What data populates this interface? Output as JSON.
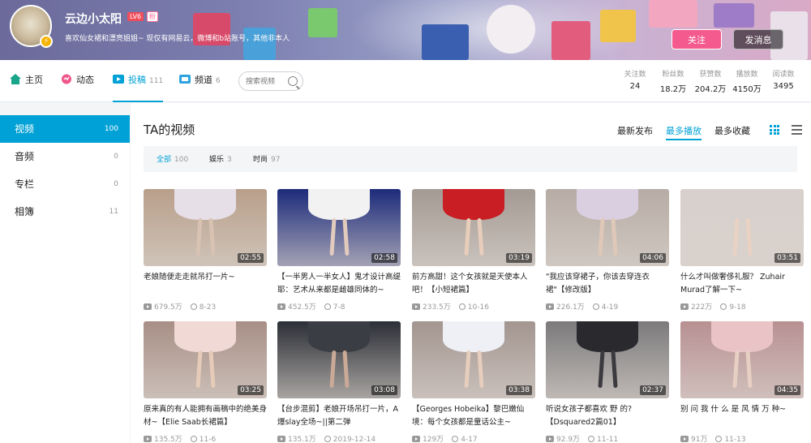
{
  "header": {
    "username": "云边小太阳",
    "level": "LV6",
    "fan_tag": "粉",
    "signature": "喜欢仙女裙和漂亮姐姐~ 现仅有网易云，微博和b站账号，其他非本人",
    "follow_label": "关注",
    "message_label": "发消息",
    "avatar_badge": "⚡"
  },
  "nav": {
    "tabs": [
      {
        "label": "主页",
        "count": ""
      },
      {
        "label": "动态",
        "count": ""
      },
      {
        "label": "投稿",
        "count": "111"
      },
      {
        "label": "频道",
        "count": "6"
      }
    ],
    "search_placeholder": "搜索视频",
    "stats": [
      {
        "label": "关注数",
        "value": "24"
      },
      {
        "label": "粉丝数",
        "value": "18.2万"
      },
      {
        "label": "获赞数",
        "value": "204.2万"
      },
      {
        "label": "播放数",
        "value": "4150万"
      },
      {
        "label": "阅读数",
        "value": "3495"
      }
    ]
  },
  "sidebar": {
    "items": [
      {
        "label": "视频",
        "count": "100"
      },
      {
        "label": "音频",
        "count": "0"
      },
      {
        "label": "专栏",
        "count": "0"
      },
      {
        "label": "相簿",
        "count": "11"
      }
    ]
  },
  "main": {
    "title": "TA的视频",
    "sort": [
      "最新发布",
      "最多播放",
      "最多收藏"
    ],
    "filters": [
      {
        "label": "全部",
        "count": "100"
      },
      {
        "label": "娱乐",
        "count": "3"
      },
      {
        "label": "时尚",
        "count": "97"
      }
    ],
    "videos": [
      {
        "title": "老娘随便走走就吊打一片~",
        "duration": "02:55",
        "plays": "679.5万",
        "date": "8-23",
        "bg": "#b89f8a",
        "skirt": "#e6dfe8",
        "leg": "#d8c2b2"
      },
      {
        "title": "【一半男人一半女人】鬼才设计高缇耶：艺术从来都是雌雄同体的~",
        "duration": "02:58",
        "plays": "452.5万",
        "date": "7-8",
        "bg": "#1d2b7a",
        "skirt": "#f2f2f2",
        "leg": "#e2cbbd"
      },
      {
        "title": "前方高甜！这个女孩就是天使本人吧！【小短裙篇】",
        "duration": "03:19",
        "plays": "233.5万",
        "date": "10-16",
        "bg": "#a49a94",
        "skirt": "#c81e24",
        "leg": "#e8cdbb"
      },
      {
        "title": "\"我应该穿裙子，你该去穿连衣裙\"【修改版】",
        "duration": "04:06",
        "plays": "226.1万",
        "date": "4-19",
        "bg": "#b7aca5",
        "skirt": "#d9cfe0",
        "leg": "#e0c8b8"
      },
      {
        "title": "什么才叫做奢侈礼服？ Zuhair Murad了解一下~",
        "duration": "03:51",
        "plays": "222万",
        "date": "9-18",
        "bg": "#d8d0cc",
        "skirt": "#d8d0cc",
        "leg": "#e9d2c4"
      },
      {
        "title": "原来真的有人能拥有画稿中的绝美身材~【Elie Saab长裙篇】",
        "duration": "03:25",
        "plays": "135.5万",
        "date": "11-6",
        "bg": "#a88f86",
        "skirt": "#f1d9d6",
        "leg": "#e6cbb9"
      },
      {
        "title": "【台步混剪】老娘开场吊打一片，A爆slay全场~||第二弹",
        "duration": "03:08",
        "plays": "135.1万",
        "date": "2019-12-14",
        "bg": "#2c2f36",
        "skirt": "#3a3d44",
        "leg": "#caa996"
      },
      {
        "title": "【Georges Hobeika】黎巴嫩仙境：每个女孩都是童话公主~",
        "duration": "03:38",
        "plays": "129万",
        "date": "4-17",
        "bg": "#a39590",
        "skirt": "#eef0f6",
        "leg": "#e6cdbc"
      },
      {
        "title": "听说女孩子都喜欢 野 的?【Dsquared2篇01】",
        "duration": "02:37",
        "plays": "92.9万",
        "date": "11-11",
        "bg": "#7c7a7c",
        "skirt": "#2a2a2e",
        "leg": "#3b3a3e"
      },
      {
        "title": "别 问 我 什 么 是 风 情 万 种~",
        "duration": "04:35",
        "plays": "91万",
        "date": "11-13",
        "bg": "#b89092",
        "skirt": "#e9c3c6",
        "leg": "#e8cfc4"
      }
    ]
  },
  "colors": {
    "accent": "#00a1d6",
    "follow": "#f45a8d"
  }
}
